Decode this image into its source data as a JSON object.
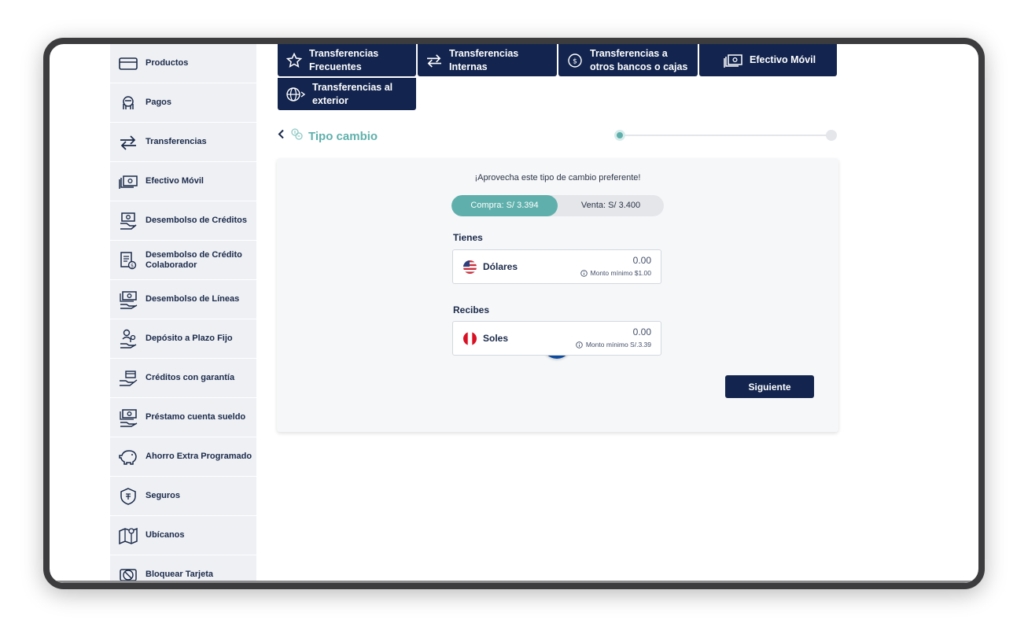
{
  "sidebar": {
    "items": [
      {
        "label": "Productos",
        "icon": "card-icon"
      },
      {
        "label": "Pagos",
        "icon": "payment-hand-icon"
      },
      {
        "label": "Transferencias",
        "icon": "transfer-arrows-icon"
      },
      {
        "label": "Efectivo Móvil",
        "icon": "cash-stack-icon"
      },
      {
        "label": "Desembolso de Créditos",
        "icon": "credit-disbursement-icon"
      },
      {
        "label": "Desembolso de Crédito Colaborador",
        "icon": "document-coin-icon"
      },
      {
        "label": "Desembolso de Líneas",
        "icon": "lines-disbursement-icon"
      },
      {
        "label": "Depósito a Plazo Fijo",
        "icon": "fixed-deposit-icon"
      },
      {
        "label": "Créditos con garantía",
        "icon": "guarantee-hand-icon"
      },
      {
        "label": "Préstamo cuenta sueldo",
        "icon": "salary-loan-icon"
      },
      {
        "label": "Ahorro Extra Programado",
        "icon": "piggy-bank-icon"
      },
      {
        "label": "Seguros",
        "icon": "shield-icon"
      },
      {
        "label": "Ubícanos",
        "icon": "map-pin-icon"
      },
      {
        "label": "Bloquear Tarjeta",
        "icon": "block-card-icon"
      }
    ]
  },
  "tabs": [
    {
      "label": "Transferencias Frecuentes",
      "icon": "star-icon"
    },
    {
      "label": "Transferencias Internas",
      "icon": "transfer-arrows-icon"
    },
    {
      "label": "Transferencias a otros bancos o cajas",
      "icon": "exchange-circle-icon"
    },
    {
      "label": "Efectivo Móvil",
      "icon": "cash-stack-icon"
    },
    {
      "label": "Transferencias al exterior",
      "icon": "globe-icon"
    }
  ],
  "page": {
    "title": "Tipo cambio",
    "back_icon": "chevron-left-icon",
    "title_icon": "coins-exchange-icon",
    "step_current": 1,
    "step_total": 2
  },
  "exchange": {
    "promo": "¡Aprovecha este tipo de cambio preferente!",
    "buy_label": "Compra: S/ 3.394",
    "sell_label": "Venta: S/ 3.400",
    "active": "buy",
    "have_label": "Tienes",
    "receive_label": "Recibes",
    "from": {
      "currency": "Dólares",
      "amount": "0.00",
      "min_text": "Monto mínimo $1.00",
      "flag": "us-flag-icon"
    },
    "to": {
      "currency": "Soles",
      "amount": "0.00",
      "min_text": "Monto mínimo S/.3.39",
      "flag": "peru-flag-icon"
    },
    "swap_icon": "swap-arrows-icon",
    "next_label": "Siguiente"
  },
  "colors": {
    "navy": "#13254f",
    "teal": "#5fb0ac",
    "swap_blue": "#0d4a9e",
    "sidebar_bg": "#eef0f4"
  }
}
